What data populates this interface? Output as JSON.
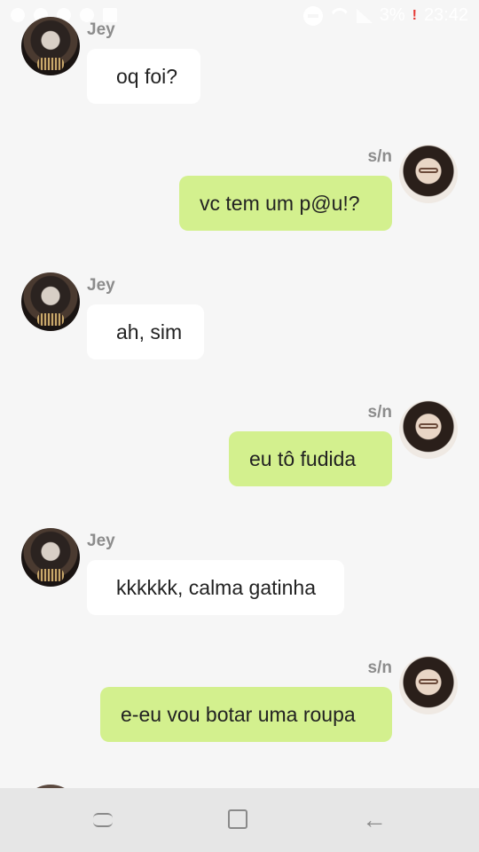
{
  "status_bar": {
    "battery": "3%",
    "time": "23:42",
    "alert": "!"
  },
  "messages": [
    {
      "sender": "Jey",
      "text": "oq foi?",
      "side": "in"
    },
    {
      "sender": "s/n",
      "text": "vc tem um p@u!?",
      "side": "out"
    },
    {
      "sender": "Jey",
      "text": "ah, sim",
      "side": "in"
    },
    {
      "sender": "s/n",
      "text": "eu tô fudida",
      "side": "out"
    },
    {
      "sender": "Jey",
      "text": "kkkkkk, calma gatinha",
      "side": "in"
    },
    {
      "sender": "s/n",
      "text": "e-eu vou botar uma roupa",
      "side": "out"
    }
  ],
  "nav_bar": {
    "back_glyph": "←"
  }
}
